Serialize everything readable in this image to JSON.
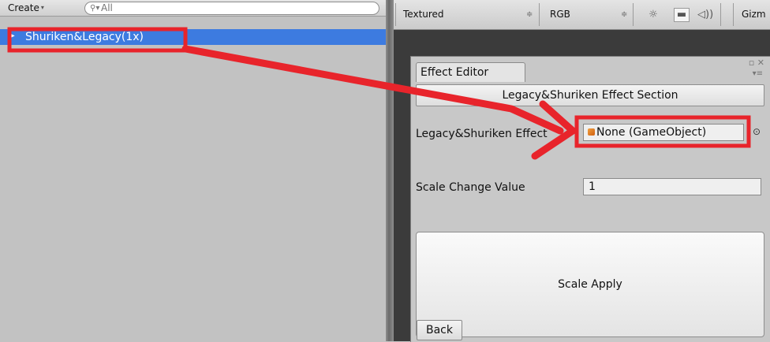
{
  "hierarchy": {
    "create_label": "Create",
    "search_placeholder": "All",
    "selected_item": "Shuriken&Legacy(1x)"
  },
  "scene_toolbar": {
    "render_mode": "Textured",
    "channel": "RGB",
    "gizmos_label": "Gizm"
  },
  "effect_editor": {
    "tab_title": "Effect Editor",
    "section_button": "Legacy&Shuriken Effect Section",
    "effect_field_label": "Legacy&Shuriken Effect",
    "effect_field_value": "None (GameObject)",
    "scale_label": "Scale Change Value",
    "scale_value": "1",
    "apply_button": "Scale Apply",
    "back_button": "Back"
  },
  "icons": {
    "search": "search-icon",
    "dropdown": "chevron-down-icon",
    "expand": "triangle-right-icon",
    "light": "sun-icon",
    "image": "image-icon",
    "audio": "speaker-icon",
    "maximize": "maximize-icon",
    "close": "close-icon",
    "menu": "menu-icon",
    "game_object": "cube-icon",
    "object_picker": "target-icon"
  },
  "colors": {
    "selection": "#3d7be0",
    "annotation": "#e8242b",
    "panel": "#c2c2c2",
    "scene_bg": "#3b3b3b"
  }
}
